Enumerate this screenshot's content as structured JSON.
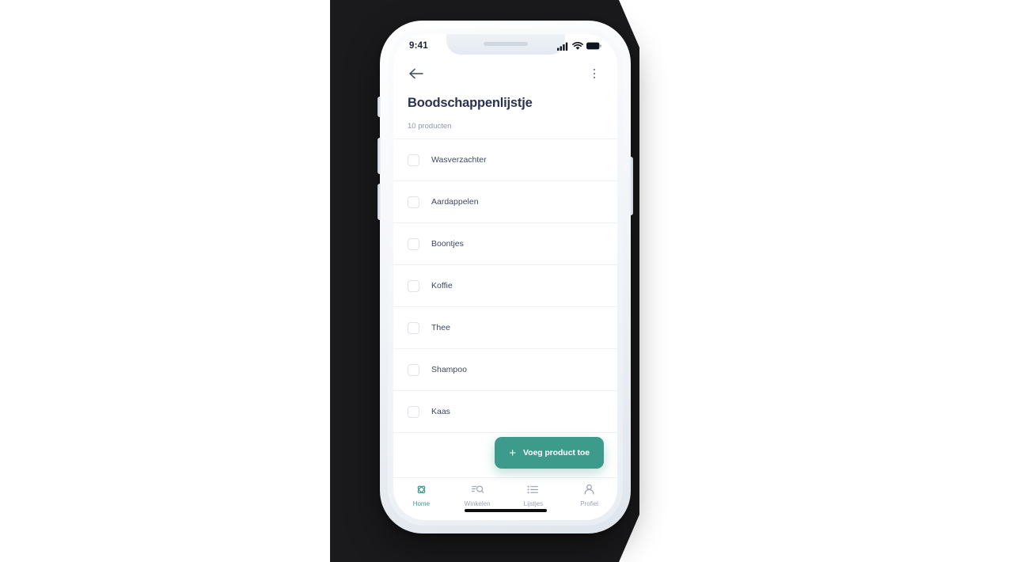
{
  "backdrop": {
    "color": "#1a1a1c"
  },
  "theme": {
    "accent": "#3d9b8c",
    "title_color": "#2a3350",
    "muted": "#8f97a8"
  },
  "status_bar": {
    "time": "9:41",
    "icons": [
      "cellular-signal-icon",
      "wifi-icon",
      "battery-icon"
    ]
  },
  "app_bar": {
    "back_icon": "arrow-left-icon",
    "overflow_icon": "kebab-menu-icon"
  },
  "header": {
    "title": "Boodschappenlijstje",
    "subtitle": "10 producten"
  },
  "list": {
    "items": [
      {
        "label": "Wasverzachter",
        "checked": false
      },
      {
        "label": "Aardappelen",
        "checked": false
      },
      {
        "label": "Boontjes",
        "checked": false
      },
      {
        "label": "Koffie",
        "checked": false
      },
      {
        "label": "Thee",
        "checked": false
      },
      {
        "label": "Shampoo",
        "checked": false
      },
      {
        "label": "Kaas",
        "checked": false
      }
    ]
  },
  "fab": {
    "plus": "+",
    "label": "Voeg product toe",
    "color": "#3d9b8c"
  },
  "tab_bar": {
    "tabs": [
      {
        "label": "Home",
        "icon": "atom-home-icon",
        "active": true
      },
      {
        "label": "Winkelen",
        "icon": "search-filter-icon",
        "active": false
      },
      {
        "label": "Lijstjes",
        "icon": "bullet-list-icon",
        "active": false
      },
      {
        "label": "Profiel",
        "icon": "person-icon",
        "active": false
      }
    ]
  }
}
